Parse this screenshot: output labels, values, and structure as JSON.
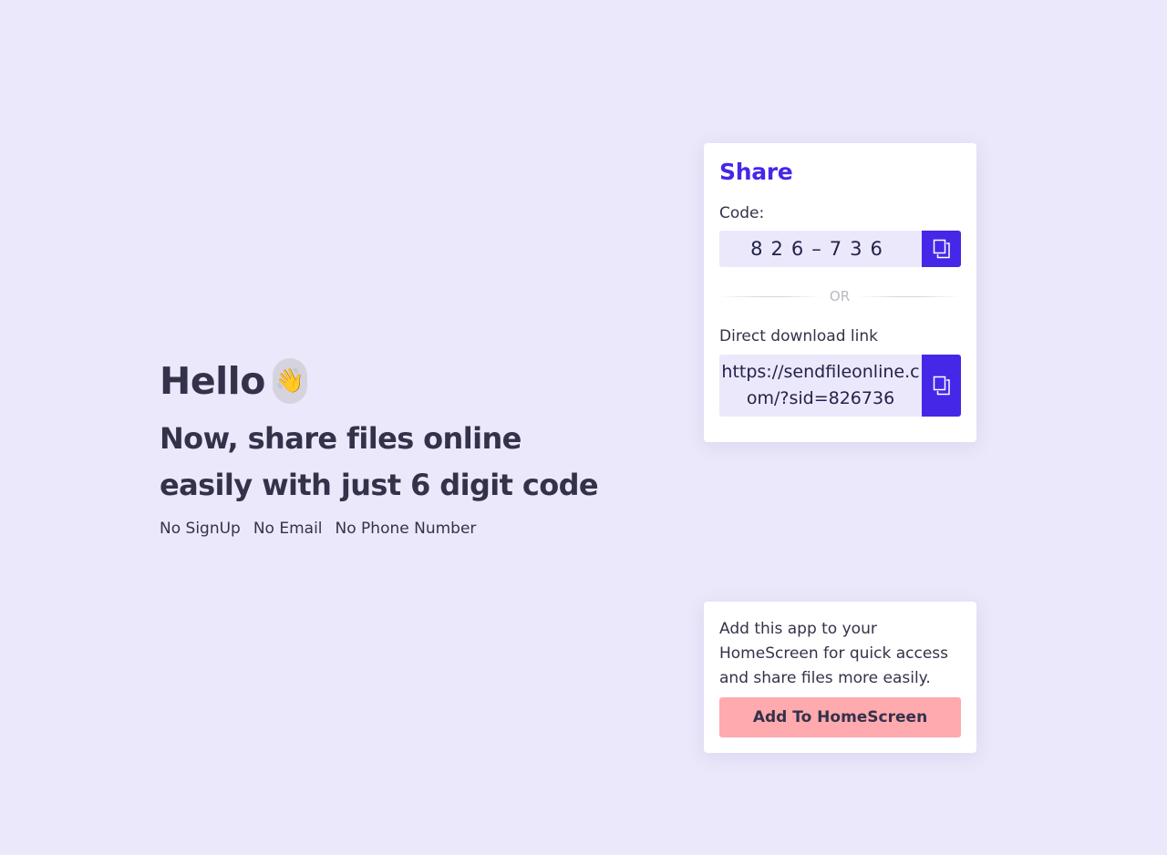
{
  "hero": {
    "greeting": "Hello",
    "wave_emoji": "👋",
    "tagline_line1": "Now, share files online",
    "tagline_line2": "easily with just 6 digit code",
    "features": [
      "No SignUp",
      "No Email",
      "No Phone Number"
    ]
  },
  "share": {
    "title": "Share",
    "code_label": "Code:",
    "code_value": "826–736",
    "copy_icon": "copy-icon",
    "divider_text": "OR",
    "link_label": "Direct download link",
    "link_value": "https://sendfileonline.com/?sid=826736"
  },
  "homescreen": {
    "message": "Add this app to your HomeScreen for quick access and share files more easily.",
    "button_label": "Add To HomeScreen"
  },
  "colors": {
    "background": "#ebe8fb",
    "accent": "#4527e8",
    "button_pink": "#feaaae",
    "text_dark": "#34324a"
  }
}
